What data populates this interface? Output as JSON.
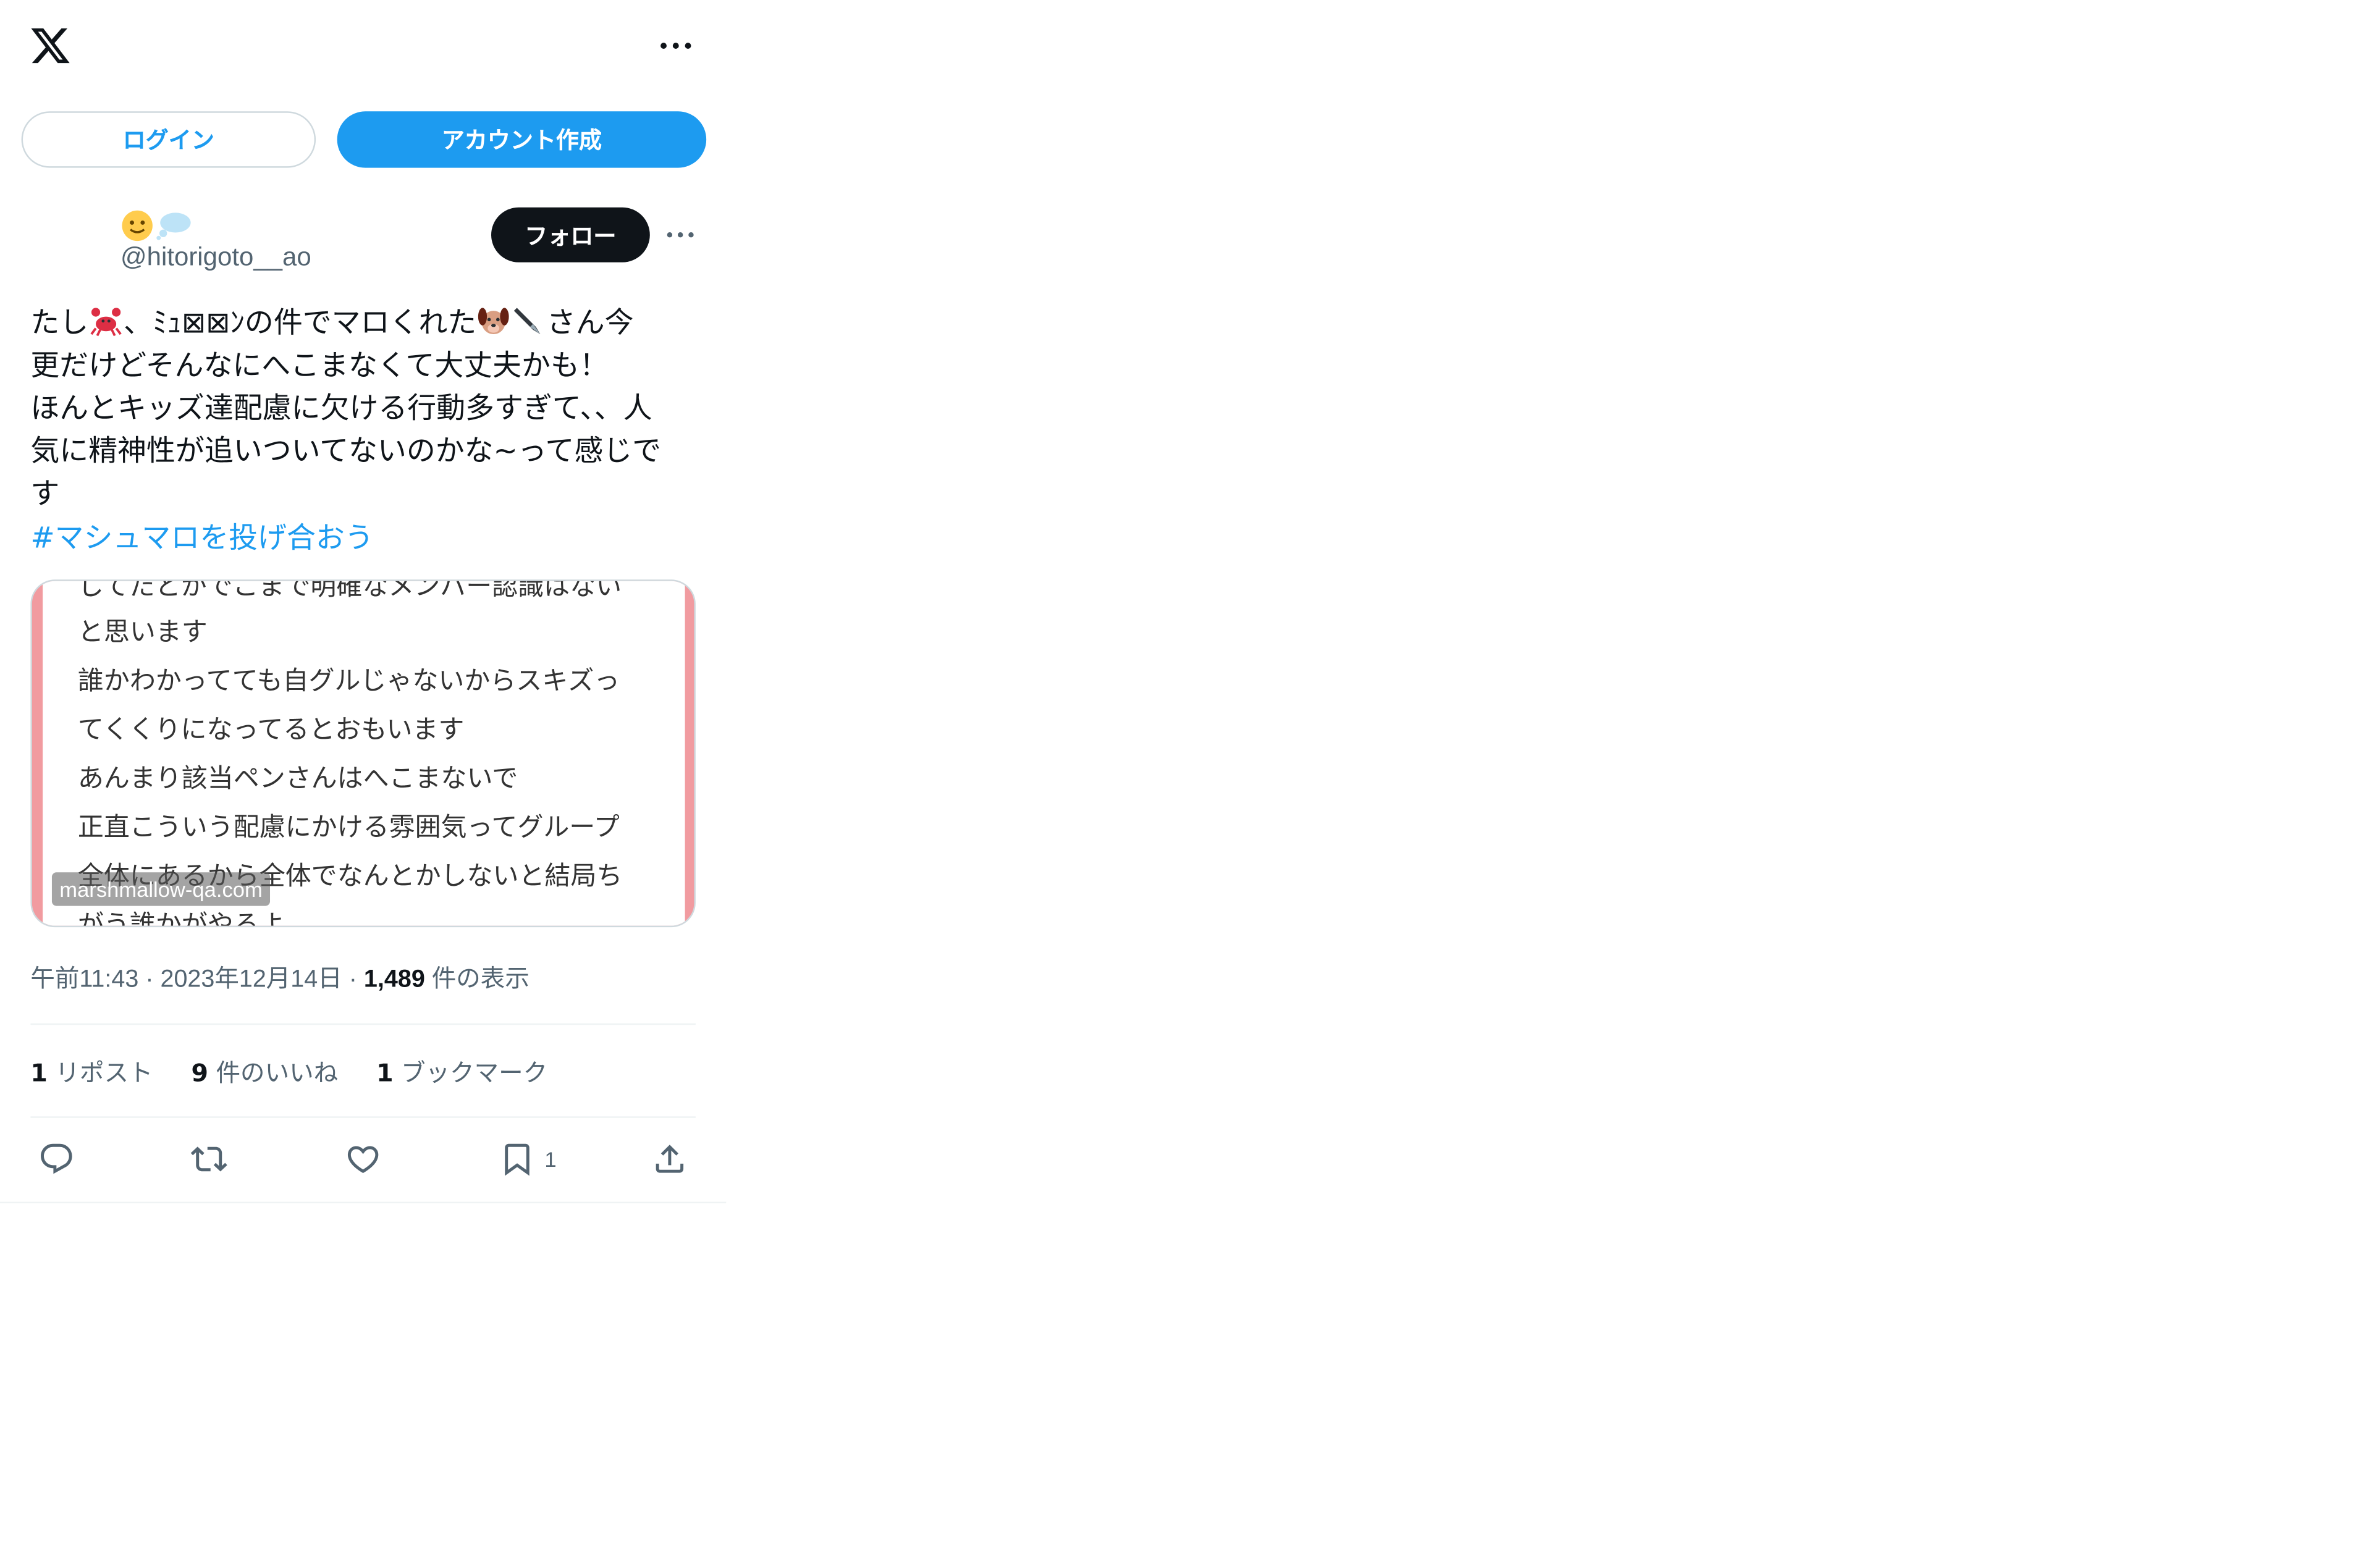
{
  "header": {
    "logo_icon": "x-logo-icon",
    "more_icon": "more-horizontal-icon"
  },
  "auth": {
    "login_label": "ログイン",
    "signup_label": "アカウント作成"
  },
  "author": {
    "display_name_icons": [
      "slightly-smiling-face-emoji",
      "thought-balloon-emoji"
    ],
    "handle": "@hitorigoto__ao",
    "follow_label": "フォロー"
  },
  "post": {
    "lines": {
      "l1a": "たし",
      "l1b": "、ﾐｭ⊠⊠ﾝの件でマロくれた",
      "l1c": "さん今",
      "l2": "更だけどそんなにへこまなくて大丈夫かも！",
      "l3": "ほんとキッズ達配慮に欠ける行動多すぎて、、人",
      "l4": "気に精神性が追いついてないのかな~って感じで",
      "l5": "す"
    },
    "inline_emojis": [
      "crab-emoji",
      "dog-face-emoji",
      "pen-emoji"
    ],
    "hashtag": "#マシュマロを投げ合おう"
  },
  "media": {
    "lines": [
      "してたとかでこまで明確なメンバー認識はない",
      "と思います",
      "誰かわかってても自グルじゃないからスキズっ",
      "てくくりになってるとおもいます",
      "あんまり該当ペンさんはへこまないで",
      "正直こういう配慮にかける雰囲気ってグループ",
      "全体にあるから全体でなんとかしないと結局ち",
      "がう誰かがやるよ、、"
    ],
    "watermark": "marshmallow-qa.com",
    "frame_color": "#f19ba0"
  },
  "meta": {
    "time": "午前11:43",
    "sep1": "·",
    "date": "2023年12月14日",
    "sep2": "·",
    "views": "1,489",
    "views_label": "件の表示"
  },
  "stats": {
    "reposts": "1",
    "reposts_label": "リポスト",
    "likes": "9",
    "likes_label": "件のいいね",
    "bookmarks": "1",
    "bookmarks_label": "ブックマーク"
  },
  "actions": {
    "bookmark_count": "1"
  },
  "colors": {
    "accent": "#1d9bf0",
    "text": "#0f1419",
    "secondary": "#536471",
    "border": "#cfd9de"
  }
}
